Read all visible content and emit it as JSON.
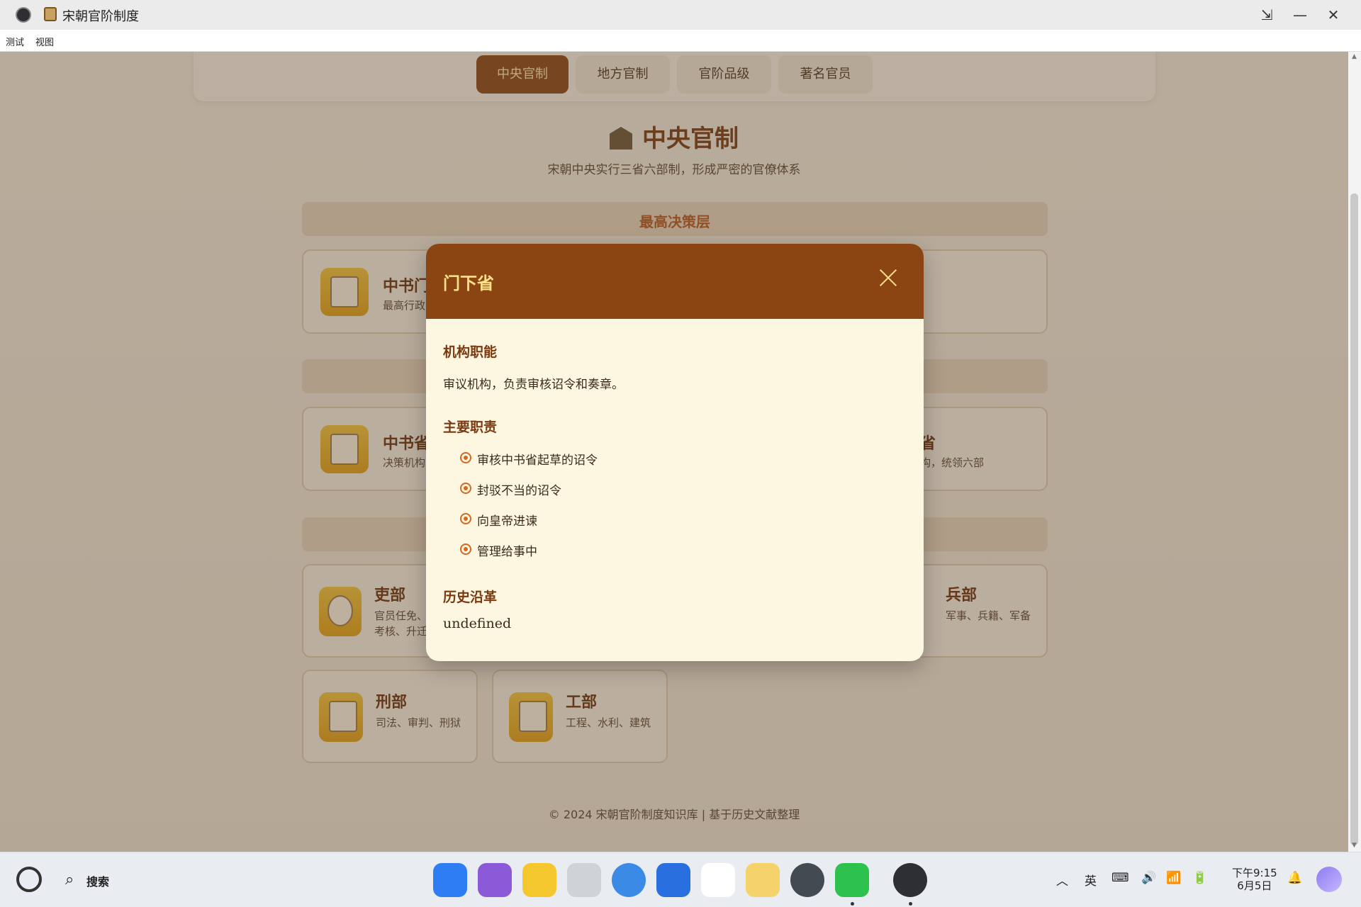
{
  "window": {
    "title": "宋朝官阶制度",
    "controls": {
      "restore": "⇲",
      "minimize": "—",
      "close": "✕"
    }
  },
  "menu": {
    "items": [
      "测试",
      "视图"
    ]
  },
  "tabs": [
    {
      "label": "中央官制",
      "active": true
    },
    {
      "label": "地方官制",
      "active": false
    },
    {
      "label": "官阶品级",
      "active": false
    },
    {
      "label": "著名官员",
      "active": false
    }
  ],
  "section": {
    "title": "中央官制",
    "subtitle": "宋朝中央实行三省六部制，形成严密的官僚体系",
    "band_top": "最高决策层"
  },
  "cards": {
    "top": {
      "name": "中书门",
      "desc": "最高行政",
      "icon": "memo-icon"
    },
    "mid_left": {
      "name": "中书省",
      "desc": "决策机构",
      "icon": "document-icon"
    },
    "mid_right": {
      "name": "省",
      "desc": "构，统领六部"
    },
    "libu": {
      "name": "吏部",
      "desc": "官员任免、考核、升迁",
      "icon": "official-icon"
    },
    "bingbu": {
      "name": "兵部",
      "desc": "军事、兵籍、军备"
    },
    "xingbu": {
      "name": "刑部",
      "desc": "司法、审判、刑狱",
      "icon": "scroll-icon"
    },
    "gongbu": {
      "name": "工部",
      "desc": "工程、水利、建筑",
      "icon": "crane-icon"
    }
  },
  "footer": {
    "text": "© 2024 宋朝官阶制度知识库 | 基于历史文献整理"
  },
  "modal": {
    "title": "门下省",
    "function_heading": "机构职能",
    "function_text": "审议机构，负责审核诏令和奏章。",
    "duties_heading": "主要职责",
    "duties": [
      "审核中书省起草的诏令",
      "封驳不当的诏令",
      "向皇帝进谏",
      "管理给事中"
    ],
    "history_heading": "历史沿革",
    "history_text": "undefined"
  },
  "taskbar": {
    "search_label": "搜索",
    "ime": "英",
    "clock_time": "下午9:15",
    "clock_date": "6月5日"
  },
  "colors": {
    "accent": "#8b4513",
    "accent_text": "#fde28a",
    "bullet": "#d2691e"
  }
}
